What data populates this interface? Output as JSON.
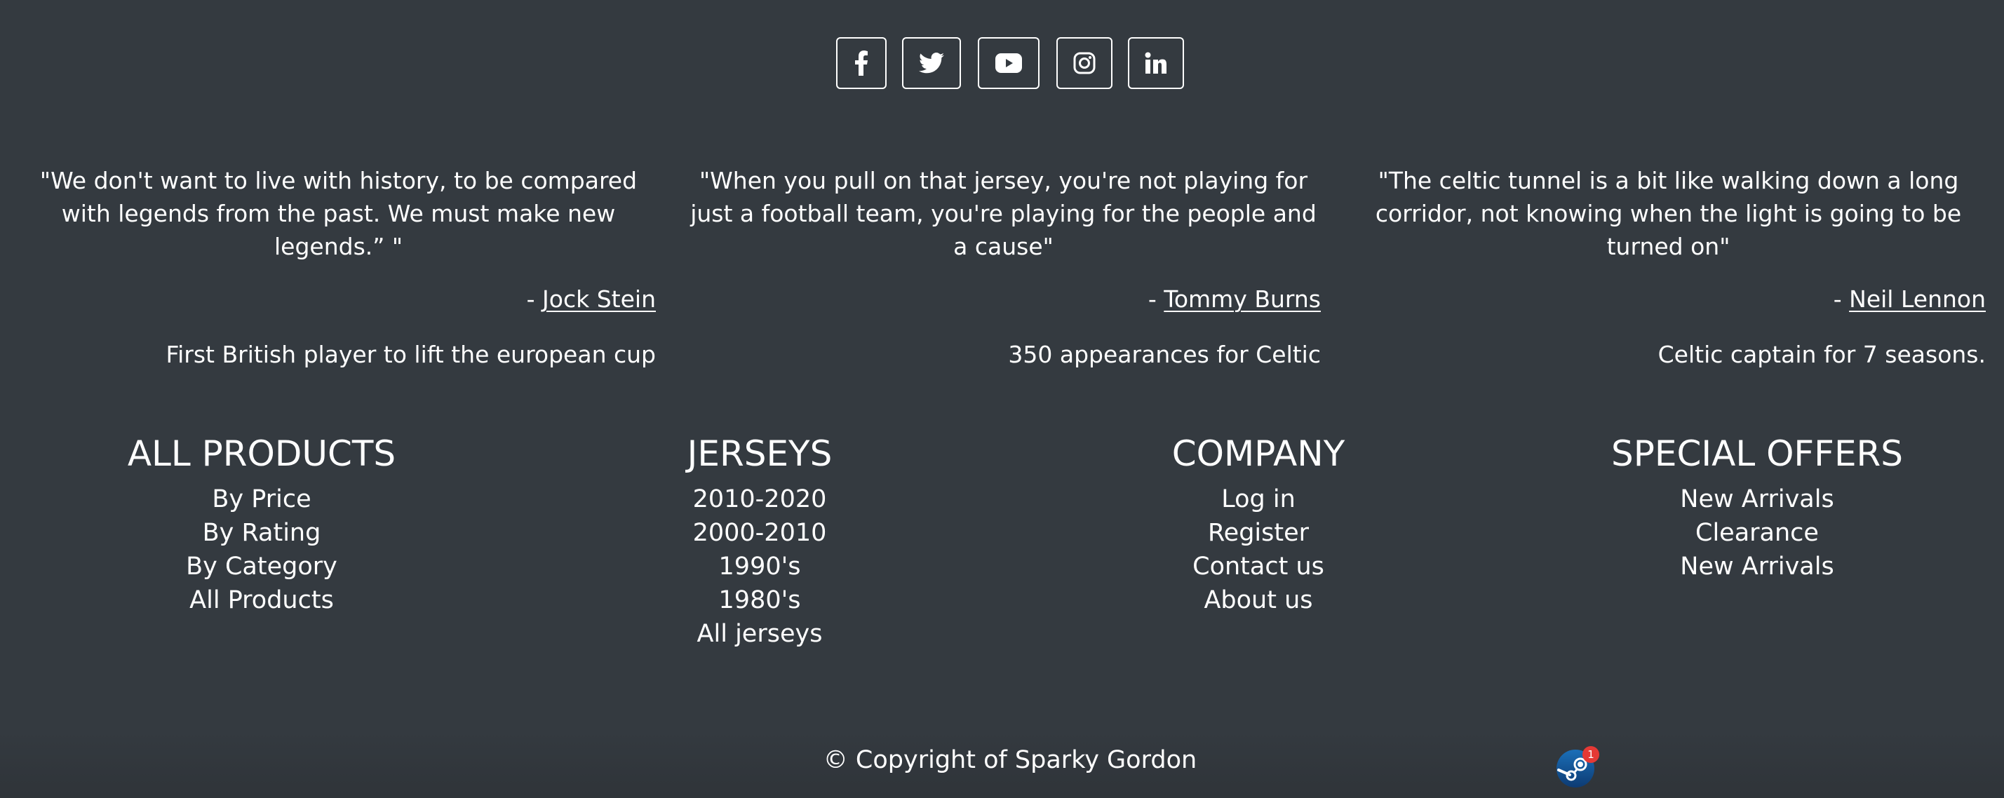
{
  "social": {
    "items": [
      {
        "icon": "facebook-icon",
        "label": "f"
      },
      {
        "icon": "twitter-icon"
      },
      {
        "icon": "youtube-icon"
      },
      {
        "icon": "instagram-icon"
      },
      {
        "icon": "linkedin-icon",
        "label": "in"
      }
    ]
  },
  "quotes": [
    {
      "text": "\"We don't want to live with history, to be compared with legends from the past. We must make new legends.”  \"",
      "dash": "- ",
      "author": "Jock Stein",
      "note": "First British player to lift the european cup"
    },
    {
      "text": "\"When you pull on that jersey, you're not playing for just a football team, you're playing for the people and a cause\"",
      "dash": "- ",
      "author": "Tommy Burns",
      "note": "350 appearances for Celtic"
    },
    {
      "text": "\"The celtic tunnel is a bit like walking down a long corridor, not knowing when the light is going to be turned on\"",
      "dash": "- ",
      "author": "Neil Lennon",
      "note": "Celtic captain for 7 seasons."
    }
  ],
  "columns": [
    {
      "title": "ALL PRODUCTS",
      "links": [
        "By Price",
        "By Rating",
        "By Category",
        "All Products"
      ]
    },
    {
      "title": "JERSEYS",
      "links": [
        "2010-2020",
        "2000-2010",
        "1990's",
        "1980's",
        "All jerseys"
      ]
    },
    {
      "title": "COMPANY",
      "links": [
        "Log in",
        "Register",
        "Contact us",
        "About us"
      ]
    },
    {
      "title": "SPECIAL OFFERS",
      "links": [
        "New Arrivals",
        "Clearance",
        "New Arrivals"
      ]
    }
  ],
  "copyright": "© Copyright of Sparky Gordon",
  "notification": {
    "icon": "steam-icon",
    "badge": "1"
  },
  "colors": {
    "background": "#343a40",
    "text": "#ffffff",
    "badge": "#e53935"
  }
}
